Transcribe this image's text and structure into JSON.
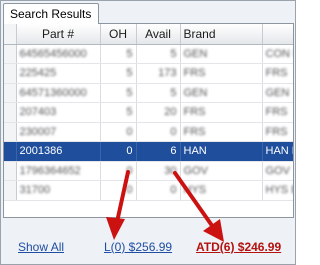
{
  "tabs": [
    {
      "label": "Search Results"
    }
  ],
  "grid": {
    "columns": [
      "Part #",
      "OH",
      "Avail",
      "Brand",
      ""
    ],
    "rows": [
      {
        "part": "64565456000",
        "oh": "5",
        "avail": "5",
        "brand": "GEN",
        "extra": "CON E",
        "selected": false,
        "blurred": true
      },
      {
        "part": "225425",
        "oh": "5",
        "avail": "173",
        "brand": "FRS",
        "extra": "FRS",
        "selected": false,
        "blurred": true
      },
      {
        "part": "64571360000",
        "oh": "5",
        "avail": "5",
        "brand": "GEN",
        "extra": "GEN",
        "selected": false,
        "blurred": true
      },
      {
        "part": "207403",
        "oh": "5",
        "avail": "20",
        "brand": "FRS",
        "extra": "FRS",
        "selected": false,
        "blurred": true
      },
      {
        "part": "230007",
        "oh": "0",
        "avail": "0",
        "brand": "FRS",
        "extra": "FRS",
        "selected": false,
        "blurred": true
      },
      {
        "part": "2001386",
        "oh": "0",
        "avail": "6",
        "brand": "HAN",
        "extra": "HAN H",
        "selected": true,
        "blurred": false
      },
      {
        "part": "1796364652",
        "oh": "0",
        "avail": "30",
        "brand": "GOV",
        "extra": "GOV",
        "selected": false,
        "blurred": true
      },
      {
        "part": "31700",
        "oh": "0",
        "avail": "0",
        "brand": "HYS",
        "extra": "HYS B",
        "selected": false,
        "blurred": true
      }
    ]
  },
  "footer": {
    "show_all": "Show All",
    "l_price": "L(0)  $256.99",
    "atd_price": "ATD(6)  $246.99"
  },
  "colors": {
    "selection": "#1f4f9c",
    "link": "#1f4ea3",
    "atd_link": "#b3120f",
    "arrow": "#cc1111"
  }
}
